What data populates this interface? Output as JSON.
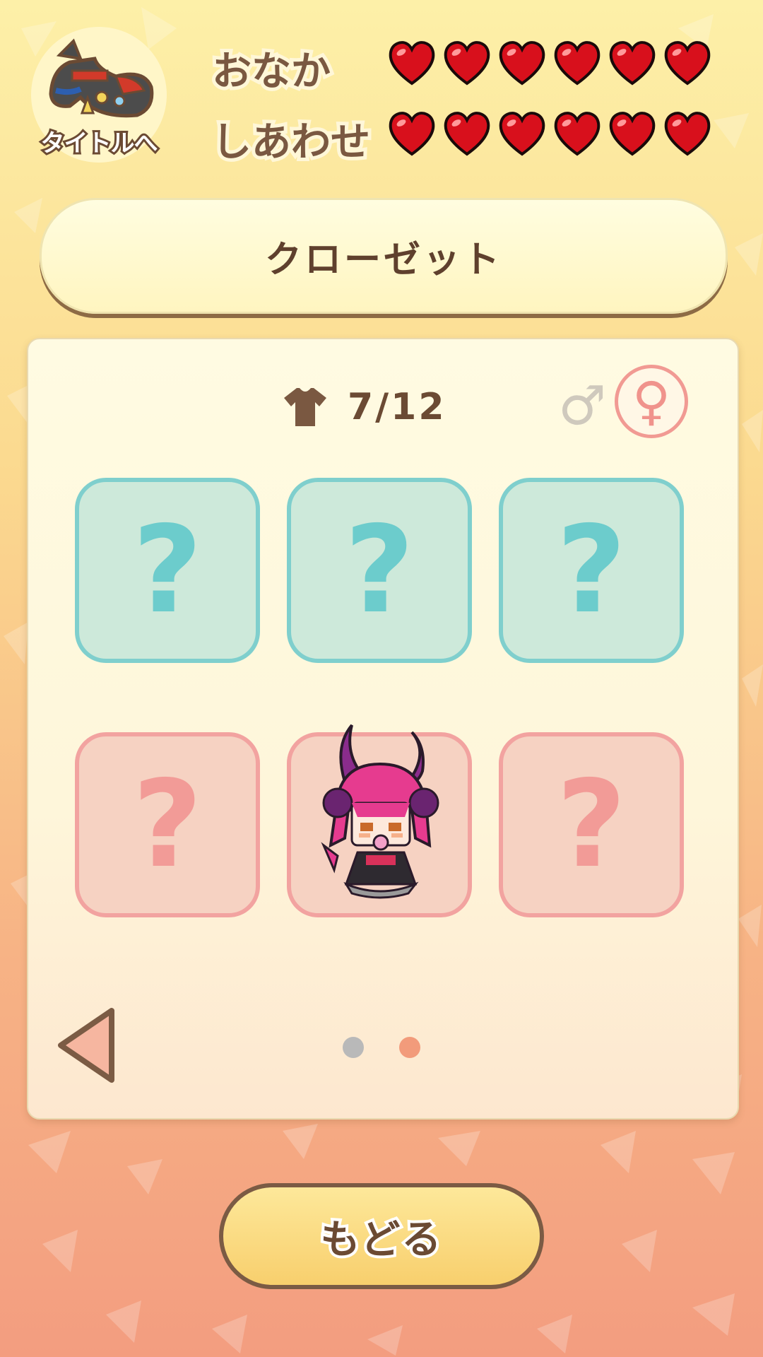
{
  "title_button": {
    "label": "タイトルへ",
    "icon": "horse-icon"
  },
  "stats": [
    {
      "label": "おなか",
      "hearts": 6
    },
    {
      "label": "しあわせ",
      "hearts": 6
    }
  ],
  "closet": {
    "title": "クローゼット",
    "counter": "7/12",
    "counter_icon": "shirt-icon",
    "gender_male_symbol": "♂",
    "gender_female_symbol": "♀",
    "selected_gender": "female",
    "slots": [
      {
        "state": "unknown",
        "color": "teal",
        "symbol": "?"
      },
      {
        "state": "unknown",
        "color": "teal",
        "symbol": "?"
      },
      {
        "state": "unknown",
        "color": "teal",
        "symbol": "?"
      },
      {
        "state": "unknown",
        "color": "pink",
        "symbol": "?"
      },
      {
        "state": "unlocked",
        "color": "pink",
        "symbol": "",
        "icon": "demon-girl-character-icon"
      },
      {
        "state": "unknown",
        "color": "pink",
        "symbol": "?"
      }
    ],
    "pagination": {
      "total": 2,
      "current": 2
    }
  },
  "back_button": {
    "label": "もどる"
  },
  "colors": {
    "heart": "#d8101c",
    "text_brown": "#6b4a33",
    "teal": "#7fcfcd",
    "pink": "#f2a3a0",
    "dot_inactive": "#b9b9b9",
    "dot_active": "#f29b7b"
  }
}
